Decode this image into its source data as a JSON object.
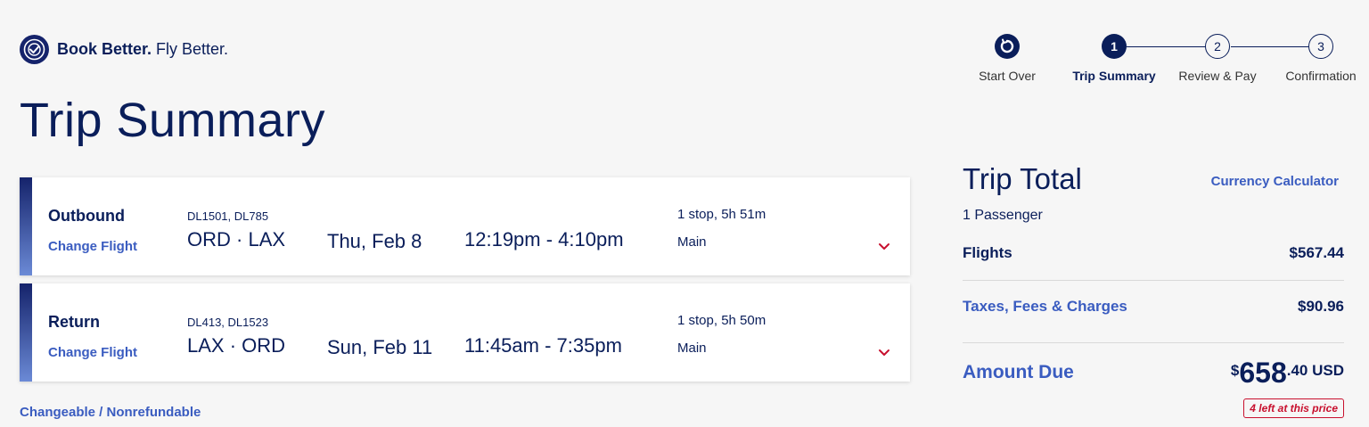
{
  "brand": {
    "logo_icon": "delta-globe-icon",
    "tagline_bold": "Book Better.",
    "tagline_rest": " Fly Better."
  },
  "stepper": {
    "start_over": {
      "label": "Start Over",
      "icon": "restart-icon"
    },
    "steps": [
      {
        "number": "1",
        "label": "Trip Summary",
        "active": true
      },
      {
        "number": "2",
        "label": "Review & Pay",
        "active": false
      },
      {
        "number": "3",
        "label": "Confirmation",
        "active": false
      }
    ]
  },
  "page_title": "Trip Summary",
  "flights": [
    {
      "type": "Outbound",
      "change_label": "Change Flight",
      "flight_numbers": "DL1501, DL785",
      "origin": "ORD",
      "destination": "LAX",
      "date": "Thu, Feb 8",
      "times": "12:19pm - 4:10pm",
      "stops": "1 stop, 5h 51m",
      "cabin": "Main"
    },
    {
      "type": "Return",
      "change_label": "Change Flight",
      "flight_numbers": "DL413, DL1523",
      "origin": "LAX",
      "destination": "ORD",
      "date": "Sun, Feb 11",
      "times": "11:45am - 7:35pm",
      "stops": "1 stop, 5h 50m",
      "cabin": "Main"
    }
  ],
  "fare_condition": "Changeable / Nonrefundable",
  "trip_total": {
    "title": "Trip Total",
    "currency_calculator": "Currency Calculator",
    "passengers": "1 Passenger",
    "flights_label": "Flights",
    "flights_value": "$567.44",
    "taxes_label": "Taxes, Fees & Charges",
    "taxes_value": "$90.96",
    "amount_due_label": "Amount Due",
    "amount_currency_symbol": "$",
    "amount_dollars": "658",
    "amount_cents": ".40 USD",
    "scarcity": "4 left at this price"
  },
  "colors": {
    "navy": "#0a1e5a",
    "link_blue": "#3a5cc0",
    "alert_red": "#c8102e"
  }
}
